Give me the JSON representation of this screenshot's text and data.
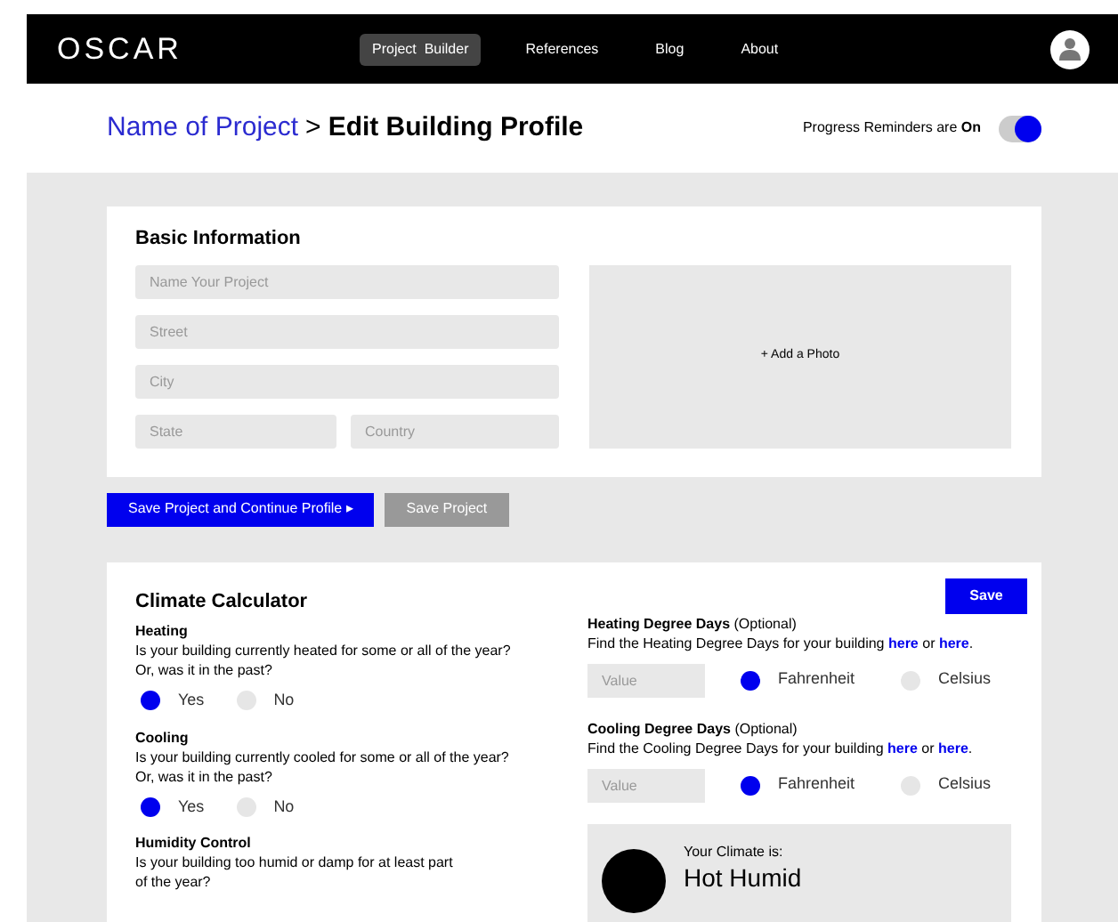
{
  "nav": {
    "logo": "OSCAR",
    "items": [
      {
        "label": "Project  Builder",
        "selected": true
      },
      {
        "label": "References",
        "selected": false
      },
      {
        "label": "Blog",
        "selected": false
      },
      {
        "label": "About",
        "selected": false
      }
    ]
  },
  "header": {
    "project": "Name of Project",
    "separator": ">",
    "title": "Edit Building Profile",
    "reminder_label": "Progress Reminders are **On**",
    "reminders_on": true
  },
  "basic": {
    "title": "Basic Information",
    "fields": [
      {
        "placeholder": "Name Your Project"
      },
      {
        "placeholder": "Street"
      },
      {
        "placeholder": "City"
      }
    ],
    "pair": [
      {
        "placeholder": "State"
      },
      {
        "placeholder": "Country"
      }
    ],
    "photo": "+ Add a Photo"
  },
  "actions": [
    {
      "label": "Save Project and Continue Profile ▸",
      "kind": "primary"
    },
    {
      "label": "Save Project",
      "kind": "secondary"
    }
  ],
  "climate": {
    "title": "Climate Calculator",
    "save": "Save",
    "questions": [
      {
        "title": "Heating",
        "text": "Is your building currently heated for some or all of the year?",
        "text2": "Or, was it in the past?",
        "options": [
          {
            "label": "Yes",
            "selected": true
          },
          {
            "label": "No",
            "selected": false
          }
        ]
      },
      {
        "title": "Cooling",
        "text": "Is your building currently cooled for some or all of the year?",
        "text2": "Or, was it in the past?",
        "options": [
          {
            "label": "Yes",
            "selected": true
          },
          {
            "label": "No",
            "selected": false
          }
        ]
      },
      {
        "title": "Humidity Control",
        "text": "Is your building too humid or damp for at least part",
        "text2": "of the year?"
      }
    ],
    "degree_days": [
      {
        "title": "**Heating Degree Days** (Optional)",
        "segments": [
          {
            "kind": "text",
            "text": "Find the Heating Degree Days for your building "
          },
          {
            "kind": "link",
            "text": "here"
          },
          {
            "kind": "text",
            "text": " or "
          },
          {
            "kind": "link",
            "text": "here"
          },
          {
            "kind": "text",
            "text": "."
          }
        ],
        "placeholder": "Value",
        "options": [
          {
            "label": "Fahrenheit",
            "selected": true
          },
          {
            "label": "Celsius",
            "selected": false
          }
        ]
      },
      {
        "title": "**Cooling Degree Days** (Optional)",
        "segments": [
          {
            "kind": "text",
            "text": "Find the Cooling Degree Days for your building "
          },
          {
            "kind": "link",
            "text": "here"
          },
          {
            "kind": "text",
            "text": " or "
          },
          {
            "kind": "link",
            "text": "here"
          },
          {
            "kind": "text",
            "text": "."
          }
        ],
        "placeholder": "Value",
        "options": [
          {
            "label": "Fahrenheit",
            "selected": true
          },
          {
            "label": "Celsius",
            "selected": false
          }
        ]
      }
    ],
    "result": {
      "label": "Your Climate is:",
      "value": "Hot Humid"
    }
  }
}
